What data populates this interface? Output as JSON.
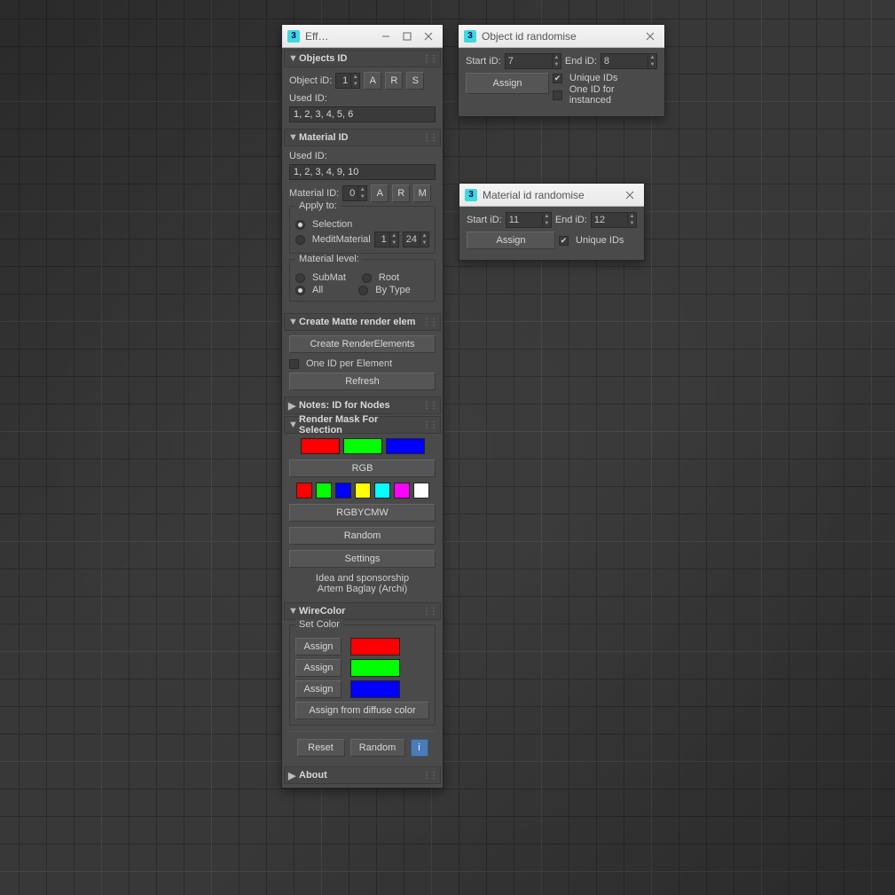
{
  "mainDialog": {
    "title": "Eff…",
    "appIcon": "3"
  },
  "objectsId": {
    "header": "Objects ID",
    "objectIdLabel": "Object iD:",
    "objectIdValue": "1",
    "btnA": "A",
    "btnR": "R",
    "btnS": "S",
    "usedLabel": "Used ID:",
    "usedValue": "1, 2, 3, 4, 5, 6"
  },
  "materialId": {
    "header": "Material ID",
    "usedLabel": "Used ID:",
    "usedValue": "1, 2, 3, 4, 9, 10",
    "matIdLabel": "Material ID:",
    "matIdValue": "0",
    "btnA": "A",
    "btnR": "R",
    "btnM": "M",
    "applyTo": {
      "label": "Apply to:",
      "selection": "Selection",
      "medit": "MeditMaterial",
      "meditA": "1",
      "meditB": "24"
    },
    "level": {
      "label": "Material level:",
      "submat": "SubMat",
      "root": "Root",
      "all": "All",
      "bytype": "By Type"
    }
  },
  "matte": {
    "header": "Create Matte render elem",
    "createBtn": "Create RenderElements",
    "oneIdPer": "One ID per Element",
    "refresh": "Refresh"
  },
  "notes": {
    "header": "Notes: ID for Nodes"
  },
  "renderMask": {
    "header": "Render Mask For Selection",
    "rgbColors": [
      "#ff0000",
      "#00ff00",
      "#0000ff"
    ],
    "rgbBtn": "RGB",
    "rgbycmwColors": [
      "#ff0000",
      "#00ff00",
      "#0000ff",
      "#ffff00",
      "#00ffff",
      "#ff00ff",
      "#ffffff"
    ],
    "rgbycmwBtn": "RGBYCMW",
    "randomBtn": "Random",
    "settingsBtn": "Settings",
    "idea": "Idea and sponsorship",
    "author": "Artem Baglay (Archi)"
  },
  "wireColor": {
    "header": "WireColor",
    "setColor": "Set Color",
    "assign": "Assign",
    "colors": [
      "#ff0000",
      "#00ff00",
      "#0000ff"
    ],
    "assignDiffuse": "Assign from diffuse color",
    "reset": "Reset",
    "random": "Random",
    "info": "i"
  },
  "about": {
    "header": "About"
  },
  "objRand": {
    "title": "Object id randomise",
    "startLabel": "Start iD:",
    "startVal": "7",
    "endLabel": "End iD:",
    "endVal": "8",
    "assign": "Assign",
    "unique": "Unique IDs",
    "oneInst": "One ID for instanced"
  },
  "matRand": {
    "title": "Material id randomise",
    "startLabel": "Start iD:",
    "startVal": "11",
    "endLabel": "End iD:",
    "endVal": "12",
    "assign": "Assign",
    "unique": "Unique IDs"
  }
}
